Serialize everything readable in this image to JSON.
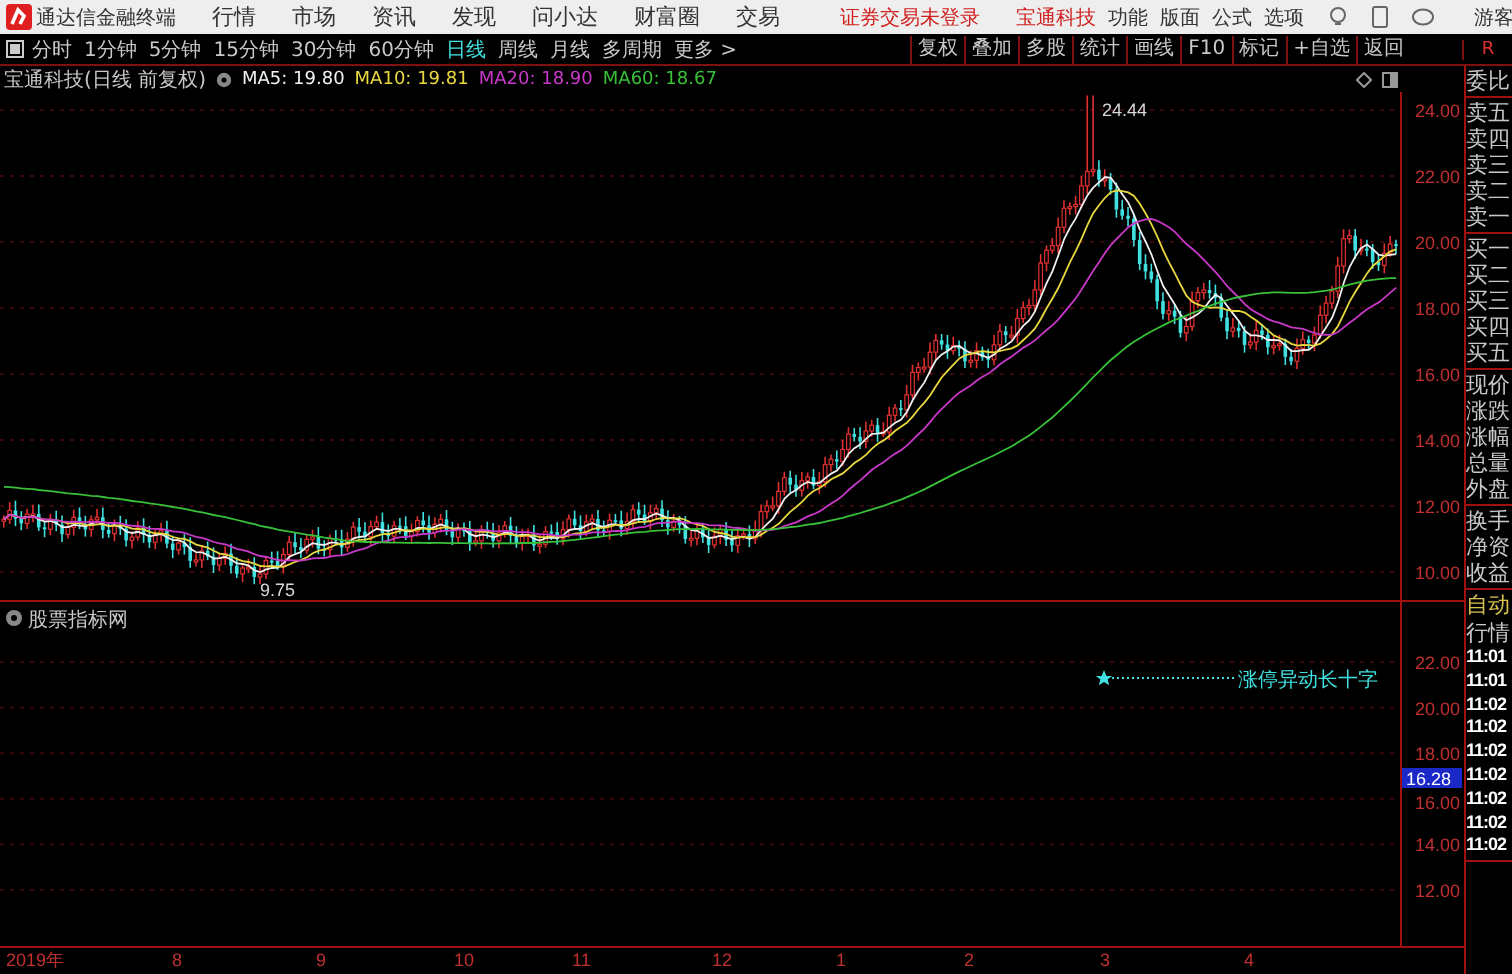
{
  "title_bar": {
    "app_name": "通达信金融终端",
    "menus": [
      "行情",
      "市场",
      "资讯",
      "发现",
      "问小达",
      "财富圈",
      "交易"
    ],
    "notice": "证券交易未登录",
    "stock_link": "宝通科技",
    "tools": [
      "功能",
      "版面",
      "公式",
      "选项"
    ],
    "user": "游客"
  },
  "toolbar": {
    "periods": [
      {
        "label": "分时",
        "selected": false
      },
      {
        "label": "1分钟",
        "selected": false
      },
      {
        "label": "5分钟",
        "selected": false
      },
      {
        "label": "15分钟",
        "selected": false
      },
      {
        "label": "30分钟",
        "selected": false
      },
      {
        "label": "60分钟",
        "selected": false
      },
      {
        "label": "日线",
        "selected": true
      },
      {
        "label": "周线",
        "selected": false
      },
      {
        "label": "月线",
        "selected": false
      },
      {
        "label": "多周期",
        "selected": false
      },
      {
        "label": "更多 >",
        "selected": false
      }
    ],
    "actions": [
      "复权",
      "叠加",
      "多股",
      "统计",
      "画线",
      "F10",
      "标记",
      "+自选",
      "返回"
    ],
    "side_label": "R"
  },
  "chart": {
    "title": "宝通科技(日线 前复权)",
    "indicators": [
      {
        "label": "MA5: 19.80",
        "color": "#f0f0f0"
      },
      {
        "label": "MA10: 19.81",
        "color": "#e8d840"
      },
      {
        "label": "MA20: 18.90",
        "color": "#c838c8"
      },
      {
        "label": "MA60: 18.67",
        "color": "#38c038"
      }
    ],
    "y_labels": [
      "24.00",
      "22.00",
      "20.00",
      "18.00",
      "16.00",
      "14.00",
      "12.00",
      "10.00"
    ],
    "high_marker": "24.44",
    "low_marker": "9.75"
  },
  "indicator_pane": {
    "title": "股票指标网",
    "signal_label": "涨停异动长十字",
    "y_labels": [
      "22.00",
      "20.00",
      "18.00",
      "16.00",
      "14.00",
      "12.00"
    ],
    "cursor_value": "16.28"
  },
  "x_axis_labels": [
    "2019年",
    "8",
    "9",
    "10",
    "11",
    "12",
    "1",
    "2",
    "3",
    "4"
  ],
  "quote_panel": {
    "groups": [
      [
        "委比"
      ],
      [
        "卖五",
        "卖四",
        "卖三",
        "卖二",
        "卖一"
      ],
      [
        "买一",
        "买二",
        "买三",
        "买四",
        "买五"
      ],
      [
        "现价",
        "涨跌",
        "涨幅",
        "总量",
        "外盘"
      ],
      [
        "换手",
        "净资",
        "收益"
      ]
    ],
    "mode": "自动",
    "mode_label": "行情",
    "times": [
      "11:01",
      "11:01",
      "11:02",
      "11:02",
      "11:02",
      "11:02",
      "11:02",
      "11:02",
      "11:02"
    ]
  }
}
